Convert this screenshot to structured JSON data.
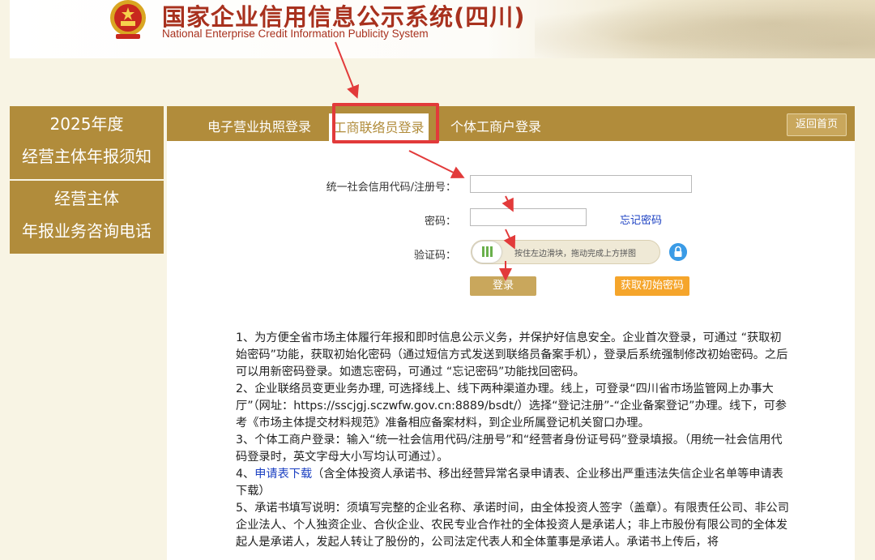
{
  "header": {
    "title": "国家企业信用信息公示系统(四川)",
    "subtitle": "National Enterprise Credit Information Publicity System"
  },
  "sidebar": {
    "items": [
      {
        "line1": "2025年度",
        "line2": "经营主体年报须知"
      },
      {
        "line1": "经营主体",
        "line2": "年报业务咨询电话"
      }
    ]
  },
  "tabs": {
    "items": [
      {
        "label": "电子营业执照登录"
      },
      {
        "label": "工商联络员登录"
      },
      {
        "label": "个体工商户登录"
      }
    ],
    "home_label": "返回首页"
  },
  "form": {
    "code_label": "统一社会信用代码/注册号：",
    "password_label": "密码：",
    "captcha_label": "验证码：",
    "forgot_label": "忘记密码",
    "slider_text": "按住左边滑块，拖动完成上方拼图",
    "login_label": "登录",
    "init_password_label": "获取初始密码"
  },
  "notes": {
    "n1": "1、为方便全省市场主体履行年报和即时信息公示义务，并保护好信息安全。企业首次登录，可通过 “获取初始密码”功能，获取初始化密码（通过短信方式发送到联络员备案手机），登录后系统强制修改初始密码。之后可以用新密码登录。如遗忘密码，可通过 “忘记密码”功能找回密码。",
    "n2": "2、企业联络员变更业务办理, 可选择线上、线下两种渠道办理。线上，可登录“四川省市场监管网上办事大厅”（网址：https://sscjgj.sczwfw.gov.cn:8889/bsdt/）选择“登记注册”-“企业备案登记”办理。线下，可参考《市场主体提交材料规范》准备相应备案材料，到企业所属登记机关窗口办理。",
    "n3": "3、个体工商户登录：输入“统一社会信用代码/注册号”和“经营者身份证号码”登录填报。（用统一社会信用代码登录时，英文字母大小写均认可通过）。",
    "n4_prefix": "4、",
    "n4_link": "申请表下载",
    "n4_suffix": "（含全体投资人承诺书、移出经营异常名录申请表、企业移出严重违法失信企业名单等申请表下载）",
    "n5": "5、承诺书填写说明：须填写完整的企业名称、承诺时间，由全体投资人签字（盖章）。有限责任公司、非公司企业法人、个人独资企业、合伙企业、农民专业合作社的全体投资人是承诺人；非上市股份有限公司的全体发起人是承诺人，发起人转让了股份的，公司法定代表人和全体董事是承诺人。承诺书上传后，将"
  },
  "colors": {
    "brand_gold": "#b18c3b",
    "title_red": "#a8311e",
    "annotation_red": "#e23a3a",
    "link_blue": "#1a3fc2",
    "init_orange": "#f5a52b"
  }
}
